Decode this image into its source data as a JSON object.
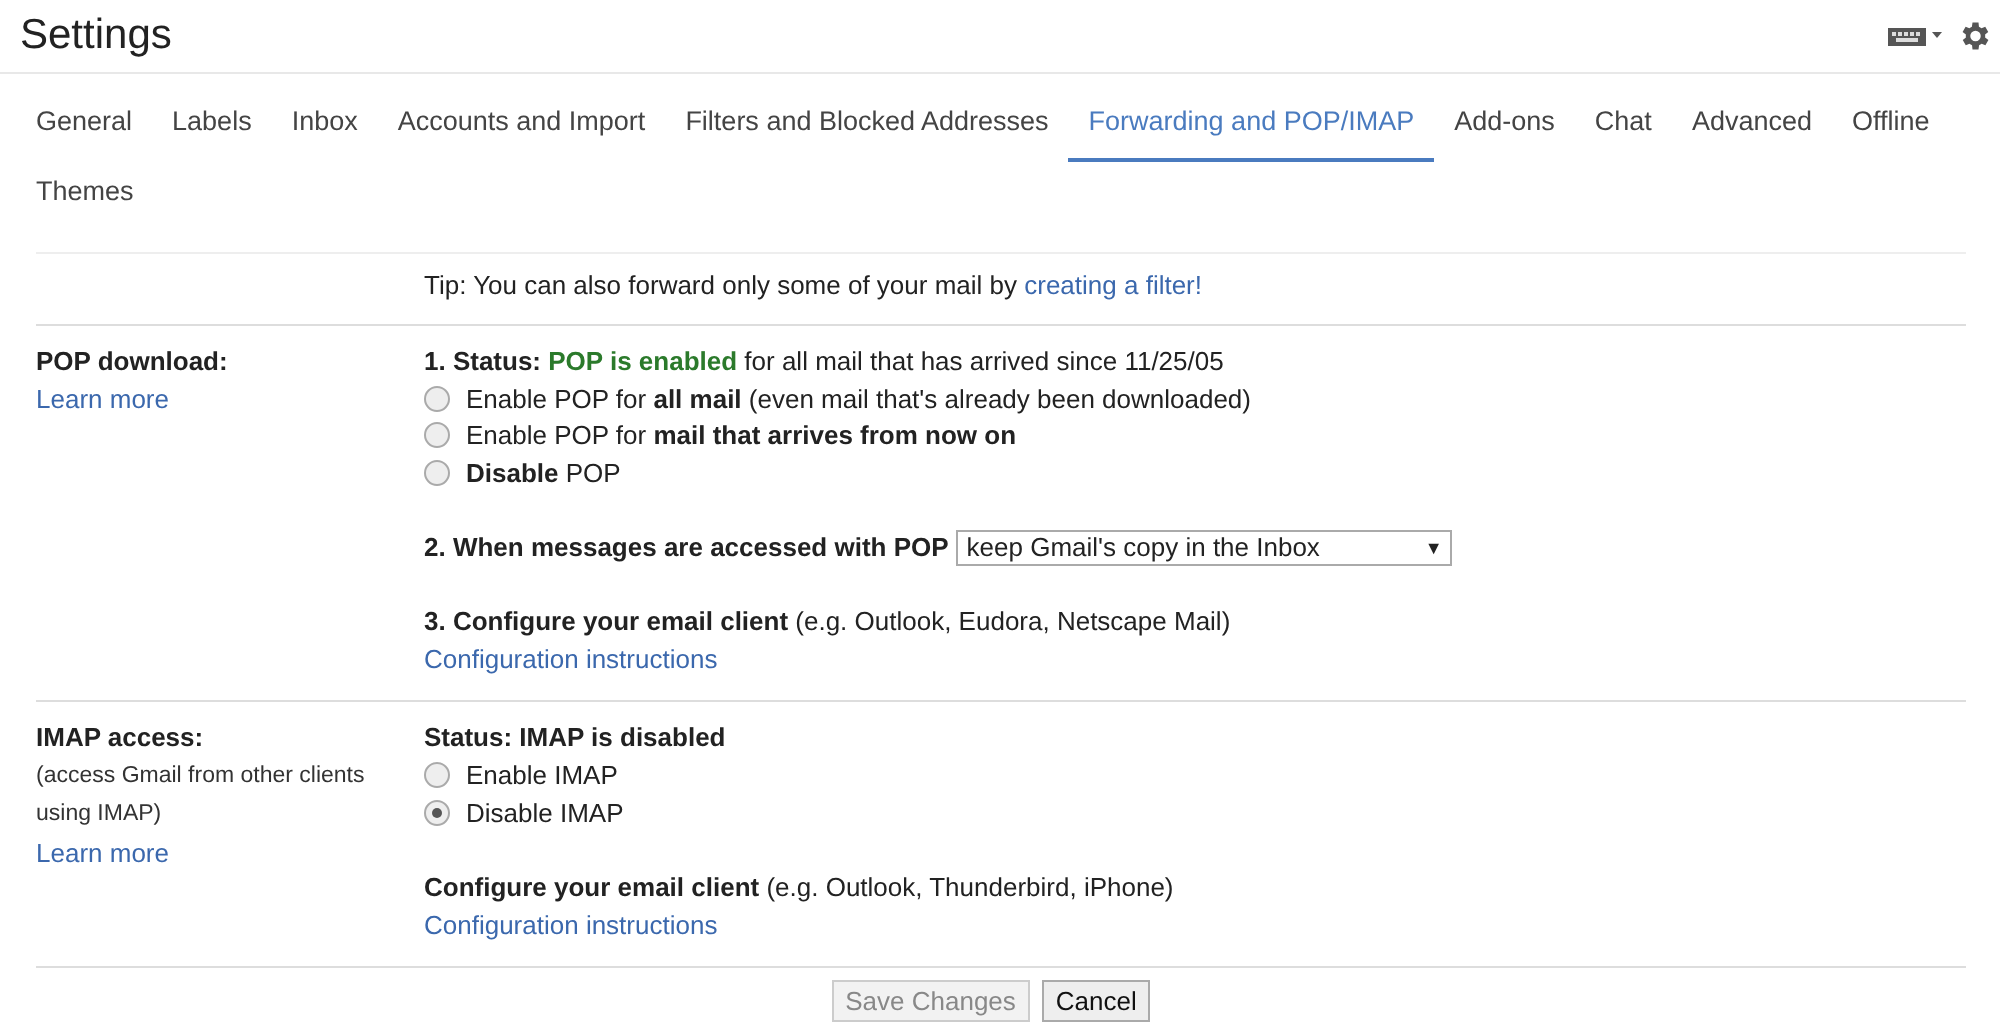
{
  "header": {
    "title": "Settings"
  },
  "tabs": [
    {
      "label": "General",
      "selected": false
    },
    {
      "label": "Labels",
      "selected": false
    },
    {
      "label": "Inbox",
      "selected": false
    },
    {
      "label": "Accounts and Import",
      "selected": false
    },
    {
      "label": "Filters and Blocked Addresses",
      "selected": false
    },
    {
      "label": "Forwarding and POP/IMAP",
      "selected": true
    },
    {
      "label": "Add-ons",
      "selected": false
    },
    {
      "label": "Chat",
      "selected": false
    },
    {
      "label": "Advanced",
      "selected": false
    },
    {
      "label": "Offline",
      "selected": false
    },
    {
      "label": "Themes",
      "selected": false
    }
  ],
  "tip": {
    "text": "Tip: You can also forward only some of your mail by",
    "link": "creating a filter!"
  },
  "pop": {
    "heading": "POP download:",
    "learn_more": "Learn more",
    "status": {
      "label": "1. Status:",
      "value": "POP is enabled",
      "rest": "for all mail that has arrived since 11/25/05"
    },
    "options": [
      {
        "label": "Enable POP for **all mail** (even mail that's already been downloaded)",
        "selected": false
      },
      {
        "label": "Enable POP for **mail that arrives from now on**",
        "selected": false
      },
      {
        "label": "**Disable** POP",
        "selected": false
      }
    ],
    "access": {
      "label": "2. When messages are accessed with POP",
      "value": "keep Gmail's copy in the Inbox",
      "arrow": "▼"
    },
    "configure": {
      "text": "**3. Configure your email client** (e.g. Outlook, Eudora, Netscape Mail)",
      "link": "Configuration instructions"
    }
  },
  "imap": {
    "heading": "IMAP access:",
    "note": "(access Gmail from other clients using IMAP)",
    "learn_more": "Learn more",
    "status": "Status: IMAP is disabled",
    "options": [
      {
        "label": "Enable IMAP",
        "selected": false
      },
      {
        "label": "Disable IMAP",
        "selected": true
      }
    ],
    "configure": {
      "text": "**Configure your email client** (e.g. Outlook, Thunderbird, iPhone)",
      "link": "Configuration instructions"
    }
  },
  "buttons": [
    {
      "label": "Save Changes",
      "disabled": true
    },
    {
      "label": "Cancel",
      "disabled": false
    }
  ]
}
